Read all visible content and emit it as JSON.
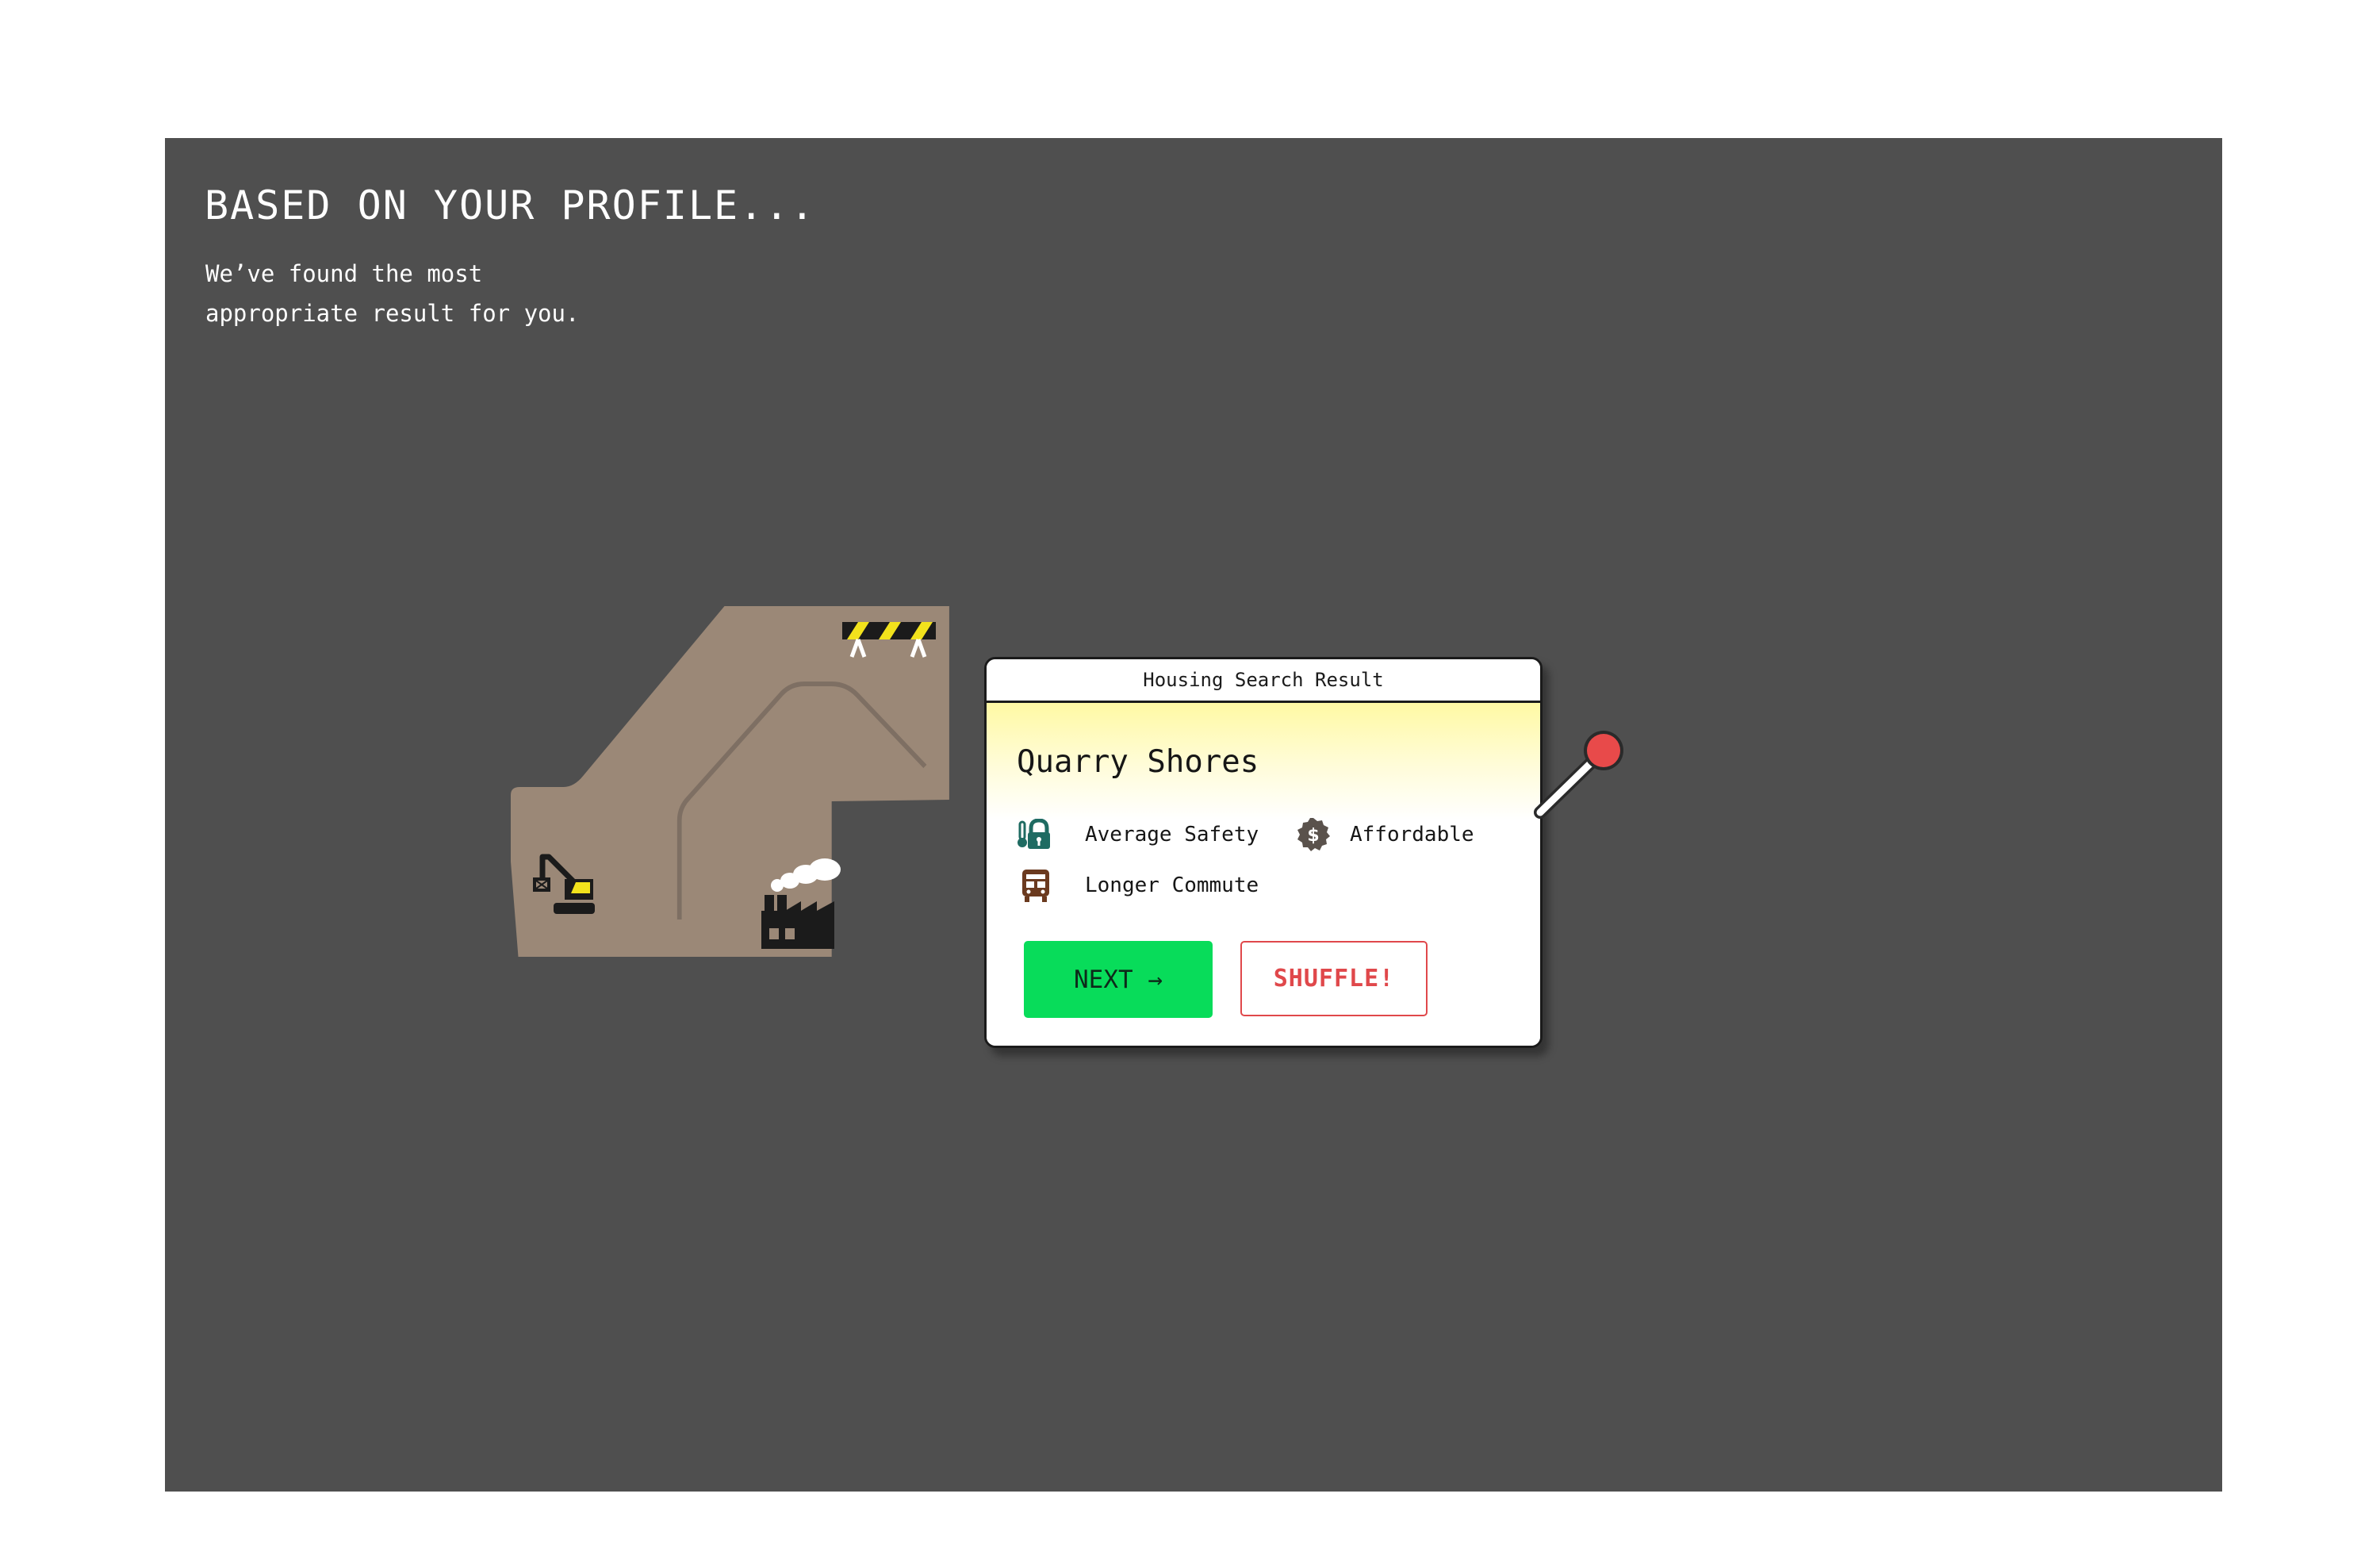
{
  "header": {
    "heading": "BASED ON YOUR PROFILE...",
    "subtext": "We’ve found the most\nappropriate result for you."
  },
  "map": {
    "land_color": "#9b8877",
    "background_color": "#4f4f4f",
    "icons": [
      "excavator-icon",
      "factory-icon",
      "road-barrier-icon"
    ]
  },
  "card": {
    "window_title": "Housing Search Result",
    "place_name": "Quarry Shores",
    "attributes": [
      {
        "label": "Average Safety",
        "icon": "thermometer-lock-icon",
        "icon_color": "#1f6b62"
      },
      {
        "label": "Affordable",
        "icon": "dollar-badge-icon",
        "icon_color": "#5a524c"
      },
      {
        "label": "Longer Commute",
        "icon": "bus-icon",
        "icon_color": "#6b3a1f"
      }
    ],
    "next_label": "NEXT →",
    "shuffle_label": "SHUFFLE!",
    "colors": {
      "next_bg": "#08dc5a",
      "shuffle_accent": "#e0484b",
      "highlight": "#fff9a4"
    }
  },
  "lever": {
    "knob_color": "#e84a4a",
    "icon": "lever-icon"
  }
}
